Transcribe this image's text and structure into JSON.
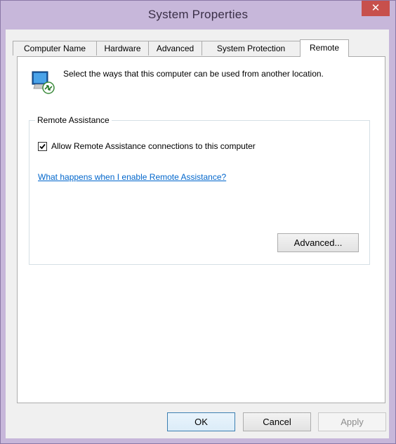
{
  "window": {
    "title": "System Properties",
    "close_symbol": "✕"
  },
  "tabs": [
    {
      "label": "Computer Name"
    },
    {
      "label": "Hardware"
    },
    {
      "label": "Advanced"
    },
    {
      "label": "System Protection"
    },
    {
      "label": "Remote"
    }
  ],
  "active_tab": "Remote",
  "intro_text": "Select the ways that this computer can be used from another location.",
  "remote_assistance": {
    "group_label": "Remote Assistance",
    "allow_label": "Allow Remote Assistance connections to this computer",
    "allow_checked": true,
    "help_link": "What happens when I enable Remote Assistance?",
    "advanced_button": "Advanced..."
  },
  "buttons": {
    "ok": "OK",
    "cancel": "Cancel",
    "apply": "Apply"
  },
  "colors": {
    "titlebar": "#c7b7da",
    "close": "#c7504c",
    "link": "#0066cc",
    "accent": "#3c7fb1"
  }
}
